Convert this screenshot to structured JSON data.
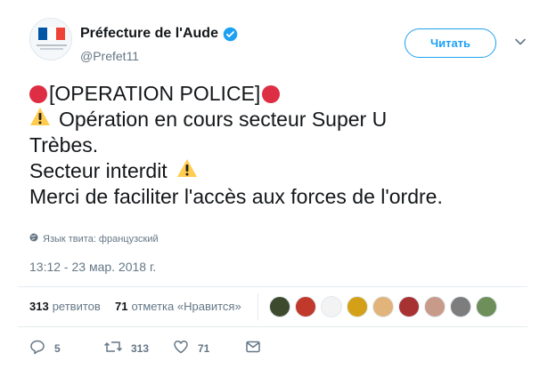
{
  "account": {
    "display_name": "Préfecture de l'Aude",
    "handle": "@Prefet11",
    "verified": true,
    "avatar_icon": "prefecture-logo",
    "flag_colors": [
      "#0055a4",
      "#ffffff",
      "#ef4135"
    ]
  },
  "header": {
    "follow_label": "Читать"
  },
  "tweet": {
    "line1": "[OPERATION POLICE]",
    "line2": "Opération en cours secteur Super U",
    "line3": "Trèbes.",
    "line4": "Secteur interdit",
    "line5": "Merci de faciliter l'accès aux forces de l'ordre."
  },
  "language_note": "Язык твита: французский",
  "timestamp": "13:12 - 23 мар. 2018 г.",
  "stats": {
    "retweets_count": "313",
    "retweets_label": "ретвитов",
    "likes_count": "71",
    "likes_label": "отметка «Нравится»"
  },
  "likers": [
    {
      "color": "#3e4a2e"
    },
    {
      "color": "#c0392b"
    },
    {
      "color": "#f3f3f3"
    },
    {
      "color": "#d4a017"
    },
    {
      "color": "#e0b47a"
    },
    {
      "color": "#a83232"
    },
    {
      "color": "#c89a8a"
    },
    {
      "color": "#7d7d7d"
    },
    {
      "color": "#6f8f5a"
    }
  ],
  "actions": {
    "reply_count": "5",
    "retweet_count": "313",
    "like_count": "71"
  },
  "colors": {
    "accent": "#1da1f2",
    "text": "#14171a",
    "secondary": "#657786",
    "alert_red": "#dd2e44",
    "warning_yellow": "#ffcc4d"
  }
}
